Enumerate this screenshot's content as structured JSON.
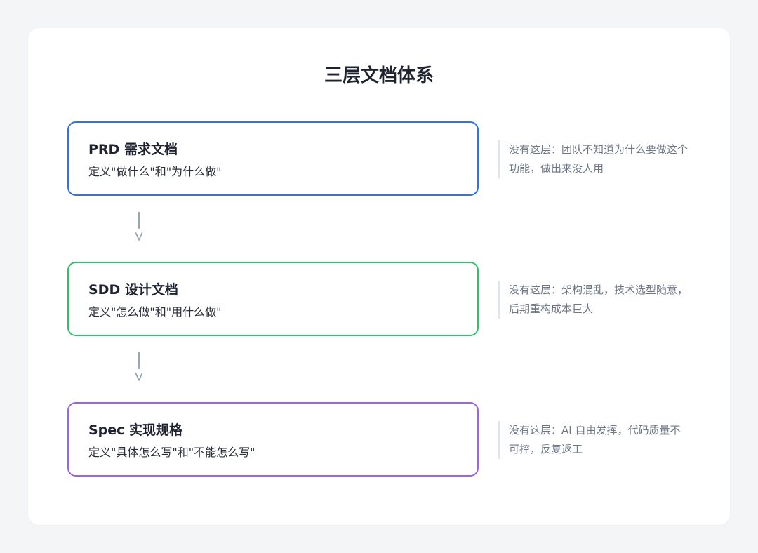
{
  "title": "三层文档体系",
  "layers": [
    {
      "name": "PRD 需求文档",
      "definition": "定义\"做什么\"和\"为什么做\"",
      "note": "没有这层：团队不知道为什么要做这个功能，做出来没人用",
      "color": "#2f74e6"
    },
    {
      "name": "SDD 设计文档",
      "definition": "定义\"怎么做\"和\"用什么做\"",
      "note": "没有这层：架构混乱，技术选型随意，后期重构成本巨大",
      "color": "#2fc26a"
    },
    {
      "name": "Spec 实现规格",
      "definition": "定义\"具体怎么写\"和\"不能怎么写\"",
      "note": "没有这层：AI 自由发挥，代码质量不可控，反复返工",
      "color": "#9a63e8"
    }
  ],
  "connector_color": "#9aa6b6",
  "background_color": "#f4f5f7"
}
